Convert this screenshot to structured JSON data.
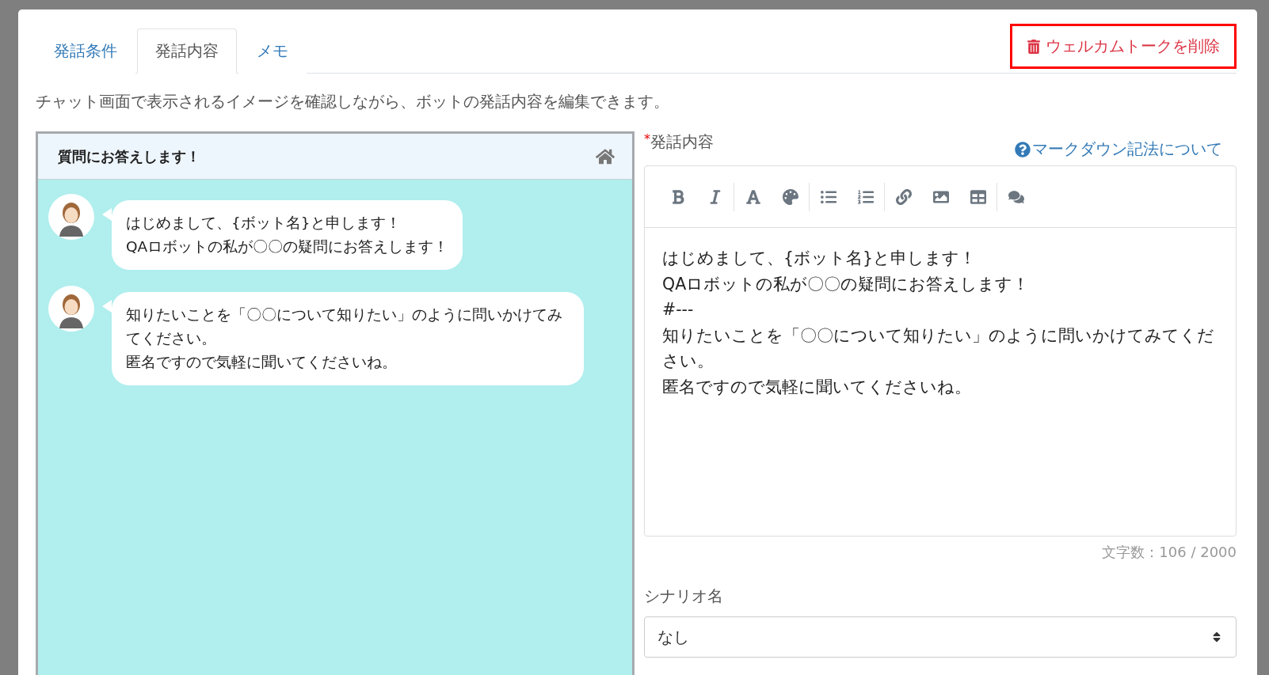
{
  "tabs": [
    {
      "label": "発話条件",
      "selected": false
    },
    {
      "label": "発話内容",
      "selected": true
    },
    {
      "label": "メモ",
      "selected": false
    }
  ],
  "delete_button": {
    "label": "ウェルカムトークを削除"
  },
  "description": "チャット画面で表示されるイメージを確認しながら、ボットの発話内容を編集できます。",
  "chat_preview": {
    "title": "質問にお答えします！",
    "messages": [
      {
        "lines": [
          "はじめまして、{ボット名}と申します！",
          "QAロボットの私が〇〇の疑問にお答えします！"
        ]
      },
      {
        "lines": [
          "知りたいことを「〇〇について知りたい」のように問いかけてみてください。",
          "匿名ですので気軽に聞いてくださいね。"
        ]
      }
    ]
  },
  "editor": {
    "required_mark": "*",
    "label": "発話内容",
    "help_link": "マークダウン記法について",
    "lines": [
      "はじめまして、{ボット名}と申します！",
      "QAロボットの私が〇〇の疑問にお答えします！",
      "#---",
      "知りたいことを「〇〇について知りたい」のように問いかけてみてください。",
      "匿名ですので気軽に聞いてくださいね。"
    ],
    "char_count": "文字数：106 / 2000"
  },
  "scenario": {
    "label": "シナリオ名",
    "value": "なし"
  }
}
